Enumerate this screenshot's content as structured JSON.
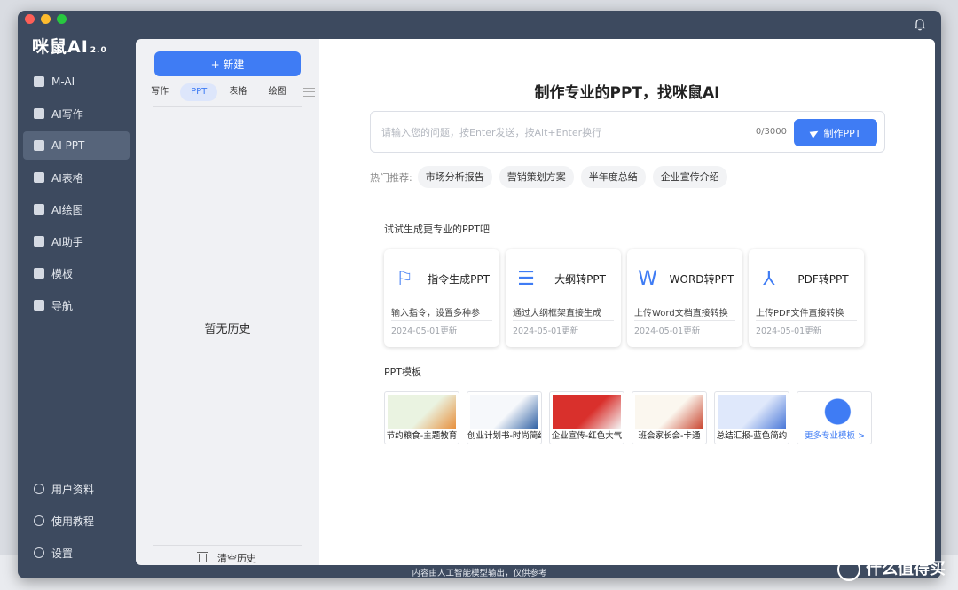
{
  "app": {
    "logo": "咪鼠AI",
    "version": "2.0"
  },
  "nav": {
    "items": [
      {
        "label": "M-AI",
        "icon": "mai-icon"
      },
      {
        "label": "AI写作",
        "icon": "write-icon"
      },
      {
        "label": "AI PPT",
        "icon": "ppt-icon",
        "active": true
      },
      {
        "label": "AI表格",
        "icon": "table-icon"
      },
      {
        "label": "AI绘图",
        "icon": "draw-icon"
      },
      {
        "label": "AI助手",
        "icon": "assistant-icon"
      },
      {
        "label": "模板",
        "icon": "template-icon"
      },
      {
        "label": "导航",
        "icon": "navigation-icon"
      }
    ],
    "bottom": [
      {
        "label": "用户资料",
        "icon": "user-icon"
      },
      {
        "label": "使用教程",
        "icon": "help-icon"
      },
      {
        "label": "设置",
        "icon": "settings-icon"
      }
    ]
  },
  "history": {
    "new_label": "+ 新建",
    "tabs": [
      "写作",
      "PPT",
      "表格",
      "绘图"
    ],
    "active_tab": "PPT",
    "empty_text": "暂无历史",
    "clear_label": "清空历史"
  },
  "main": {
    "title": "制作专业的PPT，找咪鼠AI",
    "input_placeholder": "请输入您的问题，按Enter发送，按Alt+Enter换行",
    "input_value": "",
    "counter": "0/3000",
    "make_label": "制作PPT",
    "hot_label": "热门推荐:",
    "hot_items": [
      "市场分析报告",
      "营销策划方案",
      "半年度总结",
      "企业宣传介绍"
    ],
    "section_try": "试试生成更专业的PPT吧",
    "cards": [
      {
        "name": "指令生成PPT",
        "desc": "输入指令，设置多种参",
        "date": "2024-05-01更新",
        "icon": "flag-icon",
        "glyph": "⚐"
      },
      {
        "name": "大纲转PPT",
        "desc": "通过大纲框架直接生成",
        "date": "2024-05-01更新",
        "icon": "outline-icon",
        "glyph": "☰"
      },
      {
        "name": "WORD转PPT",
        "desc": "上传Word文档直接转换",
        "date": "2024-05-01更新",
        "icon": "word-icon",
        "glyph": "W"
      },
      {
        "name": "PDF转PPT",
        "desc": "上传PDF文件直接转换",
        "date": "2024-05-01更新",
        "icon": "pdf-icon",
        "glyph": "⅄"
      }
    ],
    "section_templates": "PPT模板",
    "templates": [
      {
        "name": "节约粮食-主题教育",
        "color_a": "#eaf3e1",
        "color_b": "#e8903d"
      },
      {
        "name": "创业计划书-时尚简约",
        "color_a": "#f6f8fb",
        "color_b": "#2d5fa3"
      },
      {
        "name": "企业宣传-红色大气",
        "color_a": "#d9302c",
        "color_b": "#f4f4f4"
      },
      {
        "name": "班会家长会-卡通",
        "color_a": "#fbf7ef",
        "color_b": "#c9452f"
      },
      {
        "name": "总结汇报-蓝色简约",
        "color_a": "#dfe8fb",
        "color_b": "#4a78d8"
      }
    ],
    "more_label": "更多专业模板 >"
  },
  "footer": "内容由人工智能模型输出，仅供参考",
  "watermark": "什么值得买"
}
